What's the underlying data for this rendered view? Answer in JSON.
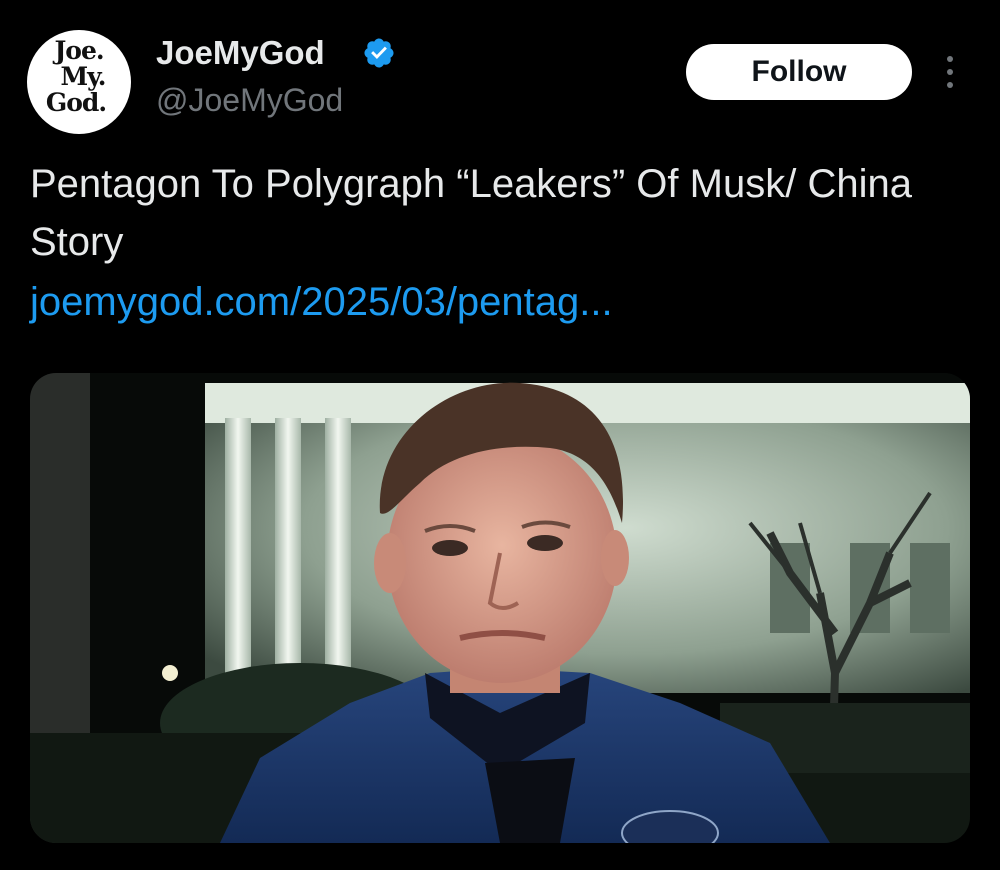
{
  "post": {
    "author": {
      "display_name": "JoeMyGod",
      "handle": "@JoeMyGod",
      "verified": true,
      "avatar_logo_lines": [
        "Joe.",
        "My.",
        "God."
      ]
    },
    "follow_label": "Follow",
    "more_icon": "more-vertical-icon",
    "text": "Pentagon To Polygraph “Leakers” Of Musk/ China Story",
    "link_text": "joemygod.com/2025/03/pentag...",
    "media": {
      "type": "photo"
    }
  },
  "colors": {
    "background": "#000000",
    "text_primary": "#e7e9ea",
    "text_secondary": "#71767b",
    "link": "#1d9bf0",
    "verified_badge": "#1d9bf0",
    "follow_button_bg": "#ffffff",
    "follow_button_text": "#0f1419"
  }
}
